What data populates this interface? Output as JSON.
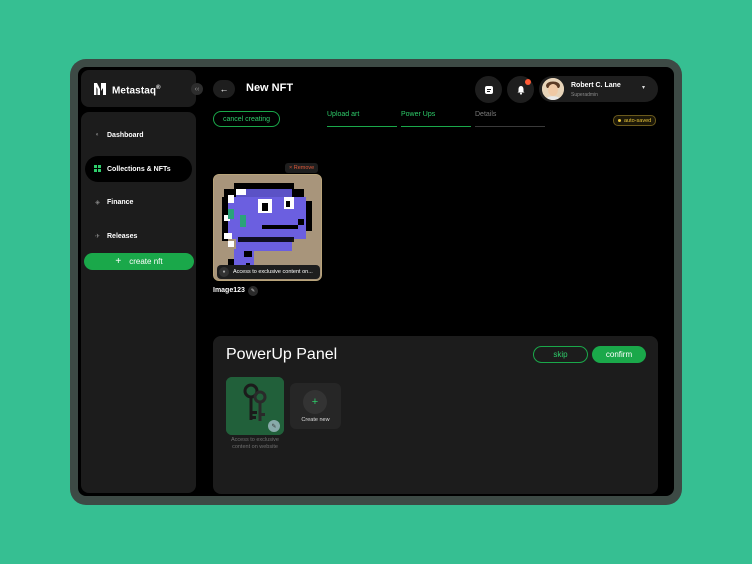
{
  "app": {
    "name": "Metastaq",
    "reg_mark": "®",
    "collapse_glyph": "‹‹"
  },
  "sidebar": {
    "items": [
      {
        "label": "Dashboard",
        "icon": "dashboard-icon",
        "glyph": "◐"
      },
      {
        "label": "Collections & NFTs",
        "icon": "grid-icon",
        "glyph": "▪",
        "active": true
      },
      {
        "label": "Finance",
        "icon": "finance-icon",
        "glyph": "◈"
      },
      {
        "label": "Releases",
        "icon": "rocket-icon",
        "glyph": "✈"
      }
    ],
    "create_button": {
      "label": "create nft",
      "icon_glyph": "+"
    }
  },
  "header": {
    "back_glyph": "←",
    "title": "New NFT",
    "user": {
      "name": "Robert C. Lane",
      "role": "Superadmin",
      "caret": "▾"
    }
  },
  "stepper": {
    "cancel_label": "cancel creating",
    "steps": [
      {
        "label": "Upload art",
        "state": "done"
      },
      {
        "label": "Power Ups",
        "state": "active"
      },
      {
        "label": "Details",
        "state": "pending"
      }
    ],
    "status_badge": "auto-saved"
  },
  "nft": {
    "remove_label": "× Remove",
    "caption": "Access to exclusive content on...",
    "name": "Image123",
    "edit_glyph": "✎"
  },
  "powerup_panel": {
    "title": "PowerUp Panel",
    "skip_label": "skip",
    "confirm_label": "confirm",
    "items": [
      {
        "caption": "Access to exclusive content on website"
      }
    ],
    "create_label": "Create new",
    "create_glyph": "+"
  },
  "colors": {
    "accent": "#1aa84a",
    "accent_text": "#2ecc6a",
    "background": "#36bf92",
    "warning": "#e9c53a",
    "danger": "#e0593a"
  }
}
